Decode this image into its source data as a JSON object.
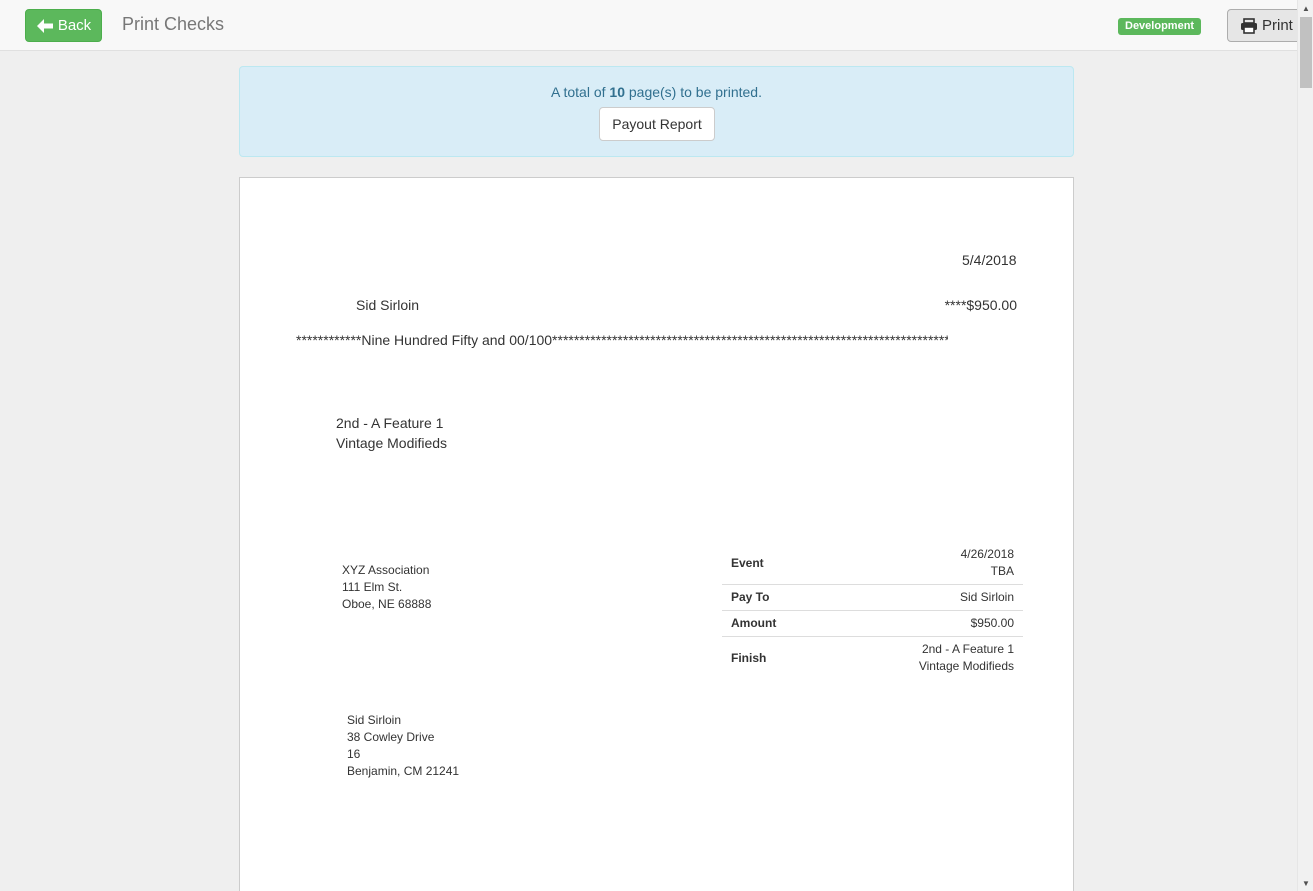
{
  "navbar": {
    "back_label": "Back",
    "title": "Print Checks",
    "env_badge": "Development",
    "print_label": "Print",
    "colors": {
      "success": "#5cb85c",
      "info_bg": "#d9edf7",
      "info_text": "#31708f"
    }
  },
  "alert": {
    "prefix": "A total of",
    "page_count": "10",
    "suffix": "page(s) to be printed.",
    "payout_label": "Payout Report"
  },
  "check": {
    "date": "5/4/2018",
    "payee": "Sid Sirloin",
    "amount": "****$950.00",
    "amount_words": "************Nine Hundred Fifty and 00/100*************************************************************************",
    "memo_line1": "2nd - A Feature 1",
    "memo_line2": "Vintage Modifieds",
    "from": {
      "name": "XYZ Association",
      "street": "111 Elm St.",
      "city": "Oboe, NE 68888"
    },
    "to": {
      "name": "Sid Sirloin",
      "street": "38 Cowley Drive",
      "unit": "16",
      "city": "Benjamin, CM 21241"
    },
    "stub": [
      {
        "label": "Event",
        "value1": "4/26/2018",
        "value2": "TBA"
      },
      {
        "label": "Pay To",
        "value1": "Sid Sirloin",
        "value2": ""
      },
      {
        "label": "Amount",
        "value1": "$950.00",
        "value2": ""
      },
      {
        "label": "Finish",
        "value1": "2nd - A Feature 1",
        "value2": "Vintage Modifieds"
      }
    ]
  },
  "icons": {
    "back": "arrow-left-icon",
    "print": "printer-icon"
  }
}
